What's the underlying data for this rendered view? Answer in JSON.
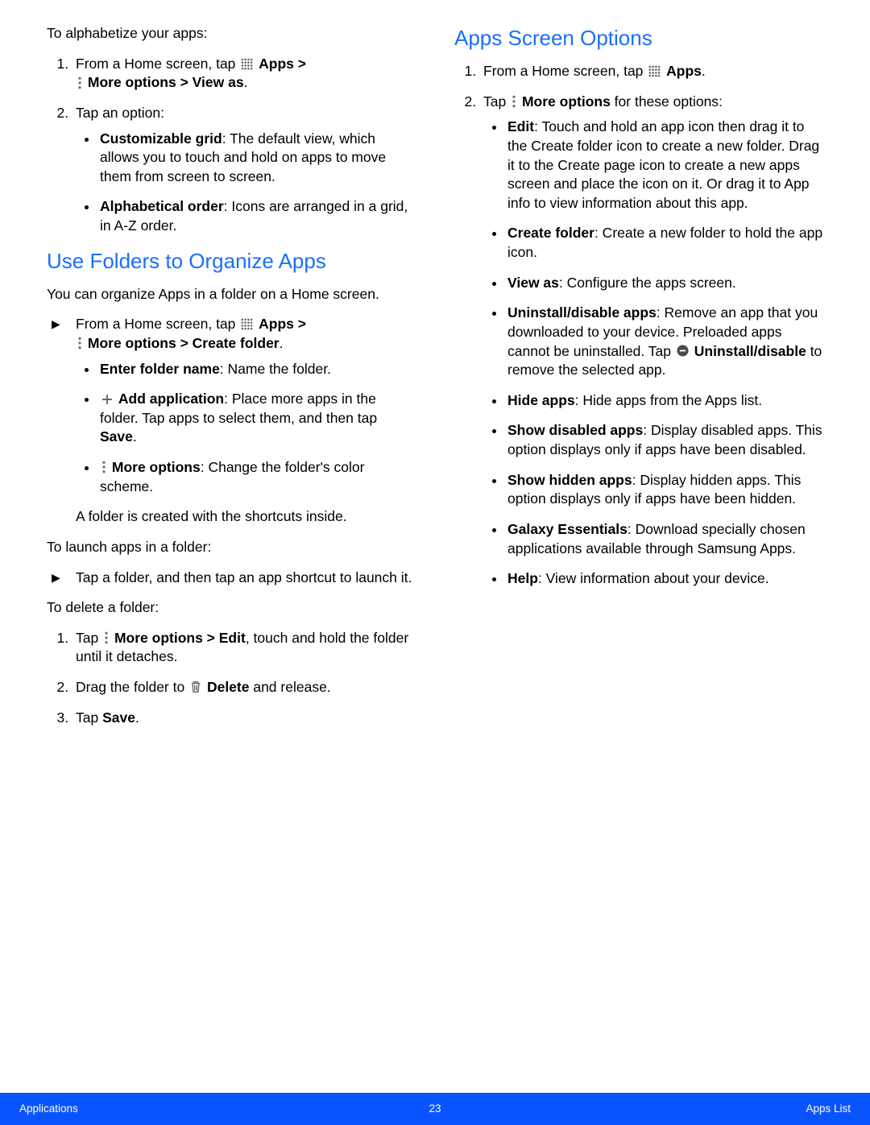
{
  "left": {
    "intro": "To alphabetize your apps:",
    "step1_a": "From a Home screen, tap ",
    "step1_apps": "Apps",
    "step1_gt": " > ",
    "step1_more": "More options > View as",
    "step1_dot": ".",
    "step2": "Tap an option:",
    "opt1_head": "Customizable grid",
    "opt1_body": ": The default view, which allows you to touch and hold on apps to move them from screen to screen.",
    "opt2_head": "Alphabetical order",
    "opt2_body": ": Icons are arranged in a grid, in A-Z order.",
    "h_folders": "Use Folders to Organize Apps",
    "folders_intro": "You can organize Apps in a folder on a Home screen.",
    "fold_step_a": "From a Home screen, tap ",
    "fold_apps": "Apps",
    "fold_gt": " > ",
    "fold_more": "More options > Create folder",
    "fold_dot": ".",
    "fold_b1_head": "Enter folder name",
    "fold_b1_body": ": Name the folder.",
    "fold_b2_head": "Add application",
    "fold_b2_body": ": Place more apps in the folder. Tap apps to select them, and then tap ",
    "fold_b2_save": "Save",
    "fold_b2_dot": ".",
    "fold_b3_head": "More options",
    "fold_b3_body": ": Change the folder's color scheme.",
    "fold_after": "A folder is created with the shortcuts inside.",
    "launch_intro": "To launch apps in a folder:",
    "launch_step": "Tap a folder, and then tap an app shortcut to launch it.",
    "delete_intro": "To delete a folder:",
    "del1_a": "Tap ",
    "del1_more": "More options > Edit",
    "del1_b": ", touch and hold the folder until it detaches.",
    "del2_a": "Drag the folder to ",
    "del2_delete": "Delete",
    "del2_b": " and release.",
    "del3_a": "Tap ",
    "del3_save": "Save",
    "del3_dot": "."
  },
  "right": {
    "h_options": "Apps Screen Options",
    "r1_a": "From a Home screen, tap ",
    "r1_apps": "Apps",
    "r1_dot": ".",
    "r2_a": "Tap ",
    "r2_more": "More options",
    "r2_b": " for these options:",
    "b1_head": "Edit",
    "b1_body": ": Touch and hold an app icon then drag it to the Create folder icon to create a new folder. Drag it to the Create page icon to create a new apps screen and place the icon on it. Or drag it to App info to view information about this app.",
    "b2_head": "Create folder",
    "b2_body": ": Create a new folder to hold the app icon.",
    "b3_head": "View as",
    "b3_body": ": Configure the apps screen.",
    "b4_head": "Uninstall/disable apps",
    "b4_body": ": Remove an app that you downloaded to your device. Preloaded apps cannot be uninstalled. Tap ",
    "b4_uninstall": "Uninstall/disable",
    "b4_body2": " to remove the selected app.",
    "b5_head": "Hide apps",
    "b5_body": ": Hide apps from the Apps list.",
    "b6_head": "Show disabled apps",
    "b6_body": ": Display disabled apps. This option displays only if apps have been disabled.",
    "b7_head": "Show hidden apps",
    "b7_body": ": Display hidden apps. This option displays only if apps have been hidden.",
    "b8_head": "Galaxy Essentials",
    "b8_body": ": Download specially chosen applications available through Samsung Apps.",
    "b9_head": "Help",
    "b9_body": ": View information about your device."
  },
  "footer": {
    "left": "Applications",
    "center": "23",
    "right": "Apps List"
  }
}
